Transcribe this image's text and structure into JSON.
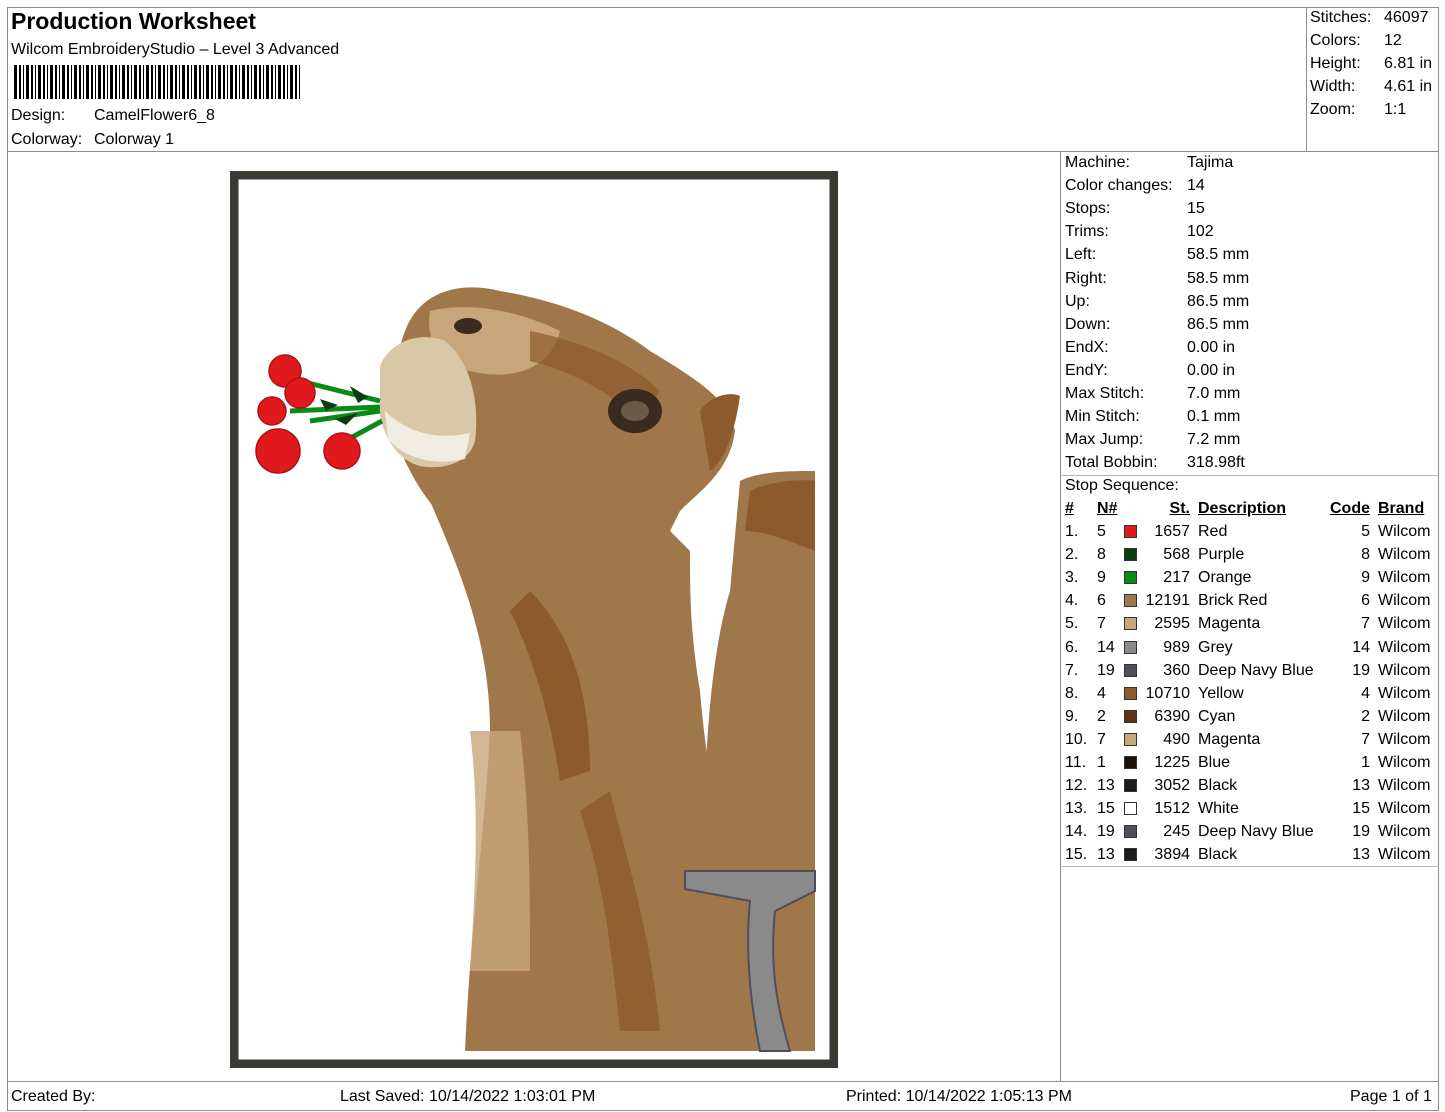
{
  "header": {
    "title": "Production Worksheet",
    "subtitle": "Wilcom EmbroideryStudio – Level 3 Advanced",
    "design_label": "Design:",
    "design_value": "CamelFlower6_8",
    "colorway_label": "Colorway:",
    "colorway_value": "Colorway 1"
  },
  "stats": [
    {
      "label": "Stitches:",
      "value": "46097"
    },
    {
      "label": "Colors:",
      "value": "12"
    },
    {
      "label": "Height:",
      "value": "6.81 in"
    },
    {
      "label": "Width:",
      "value": "4.61 in"
    },
    {
      "label": "Zoom:",
      "value": "1:1"
    }
  ],
  "machine_info": [
    {
      "label": "Machine:",
      "value": "Tajima"
    },
    {
      "label": "Color changes:",
      "value": "14"
    },
    {
      "label": "Stops:",
      "value": "15"
    },
    {
      "label": "Trims:",
      "value": "102"
    },
    {
      "label": "Left:",
      "value": "58.5 mm"
    },
    {
      "label": "Right:",
      "value": "58.5 mm"
    },
    {
      "label": "Up:",
      "value": "86.5 mm"
    },
    {
      "label": "Down:",
      "value": "86.5 mm"
    },
    {
      "label": "EndX:",
      "value": "0.00 in"
    },
    {
      "label": "EndY:",
      "value": "0.00 in"
    },
    {
      "label": "Max Stitch:",
      "value": "7.0 mm"
    },
    {
      "label": "Min Stitch:",
      "value": "0.1 mm"
    },
    {
      "label": "Max Jump:",
      "value": "7.2 mm"
    },
    {
      "label": "Total Bobbin:",
      "value": "318.98ft"
    }
  ],
  "stop_sequence": {
    "title": "Stop Sequence:",
    "columns": {
      "num": "#",
      "n": "N#",
      "st": "St.",
      "desc": "Description",
      "code": "Code",
      "brand": "Brand"
    },
    "rows": [
      {
        "idx": "1.",
        "n": "5",
        "color": "#e0191d",
        "st": "1657",
        "desc": "Red",
        "code": "5",
        "brand": "Wilcom"
      },
      {
        "idx": "2.",
        "n": "8",
        "color": "#0b3d10",
        "st": "568",
        "desc": "Purple",
        "code": "8",
        "brand": "Wilcom"
      },
      {
        "idx": "3.",
        "n": "9",
        "color": "#0b8a19",
        "st": "217",
        "desc": "Orange",
        "code": "9",
        "brand": "Wilcom"
      },
      {
        "idx": "4.",
        "n": "6",
        "color": "#a0774a",
        "st": "12191",
        "desc": "Brick Red",
        "code": "6",
        "brand": "Wilcom"
      },
      {
        "idx": "5.",
        "n": "7",
        "color": "#c8a57a",
        "st": "2595",
        "desc": "Magenta",
        "code": "7",
        "brand": "Wilcom"
      },
      {
        "idx": "6.",
        "n": "14",
        "color": "#8a8a8a",
        "st": "989",
        "desc": "Grey",
        "code": "14",
        "brand": "Wilcom"
      },
      {
        "idx": "7.",
        "n": "19",
        "color": "#4f4f5c",
        "st": "360",
        "desc": "Deep Navy Blue",
        "code": "19",
        "brand": "Wilcom"
      },
      {
        "idx": "8.",
        "n": "4",
        "color": "#8c5a2c",
        "st": "10710",
        "desc": "Yellow",
        "code": "4",
        "brand": "Wilcom"
      },
      {
        "idx": "9.",
        "n": "2",
        "color": "#5c3212",
        "st": "6390",
        "desc": "Cyan",
        "code": "2",
        "brand": "Wilcom"
      },
      {
        "idx": "10.",
        "n": "7",
        "color": "#c8a57a",
        "st": "490",
        "desc": "Magenta",
        "code": "7",
        "brand": "Wilcom"
      },
      {
        "idx": "11.",
        "n": "1",
        "color": "#1e0f0a",
        "st": "1225",
        "desc": "Blue",
        "code": "1",
        "brand": "Wilcom"
      },
      {
        "idx": "12.",
        "n": "13",
        "color": "#1a1a1a",
        "st": "3052",
        "desc": "Black",
        "code": "13",
        "brand": "Wilcom"
      },
      {
        "idx": "13.",
        "n": "15",
        "color": "#ffffff",
        "st": "1512",
        "desc": "White",
        "code": "15",
        "brand": "Wilcom"
      },
      {
        "idx": "14.",
        "n": "19",
        "color": "#4f4f5c",
        "st": "245",
        "desc": "Deep Navy Blue",
        "code": "19",
        "brand": "Wilcom"
      },
      {
        "idx": "15.",
        "n": "13",
        "color": "#1a1a1a",
        "st": "3894",
        "desc": "Black",
        "code": "13",
        "brand": "Wilcom"
      }
    ]
  },
  "footer": {
    "created_by": "Created By:",
    "last_saved": "Last Saved: 10/14/2022 1:03:01 PM",
    "printed": "Printed: 10/14/2022 1:05:13 PM",
    "page": "Page 1 of 1"
  },
  "colors": {
    "frame_border": "#3a3a34",
    "camel_main": "#a0774a",
    "camel_light": "#c8a57a",
    "camel_dark": "#5c3212",
    "flower_red": "#e0191d",
    "stem_green": "#0b8a19",
    "strap_grey": "#8a8a8a"
  }
}
